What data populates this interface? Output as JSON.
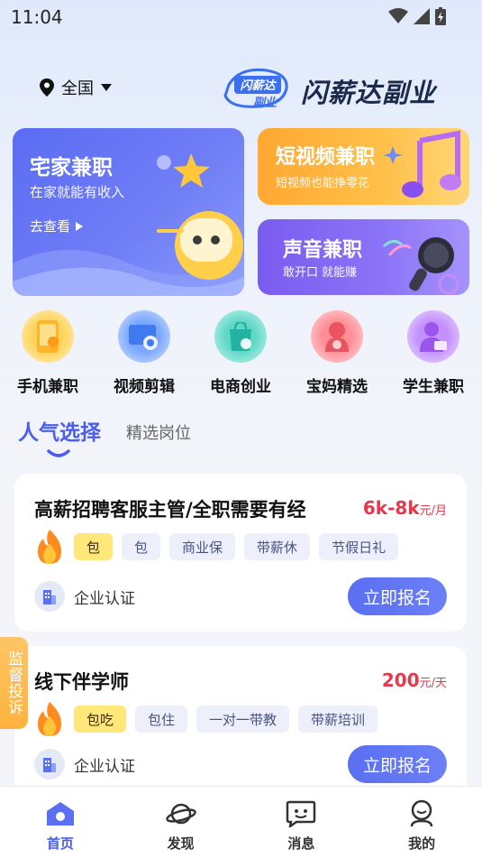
{
  "status_bar": {
    "time": "11:04"
  },
  "header": {
    "location": "全国",
    "brand_name": "闪薪达副业",
    "logo_mark_text": "闪薪达副业"
  },
  "banners": {
    "home": {
      "title": "宅家兼职",
      "subtitle": "在家就能有收入",
      "link": "去查看"
    },
    "video": {
      "title": "短视频兼职",
      "subtitle": "短视频也能挣零花"
    },
    "voice": {
      "title": "声音兼职",
      "subtitle": "敢开口 就能赚"
    }
  },
  "categories": [
    {
      "label": "手机兼职",
      "icon": "phone-icon",
      "color": "#ffc94a"
    },
    {
      "label": "视频剪辑",
      "icon": "video-edit-icon",
      "color": "#5b8ff5"
    },
    {
      "label": "电商创业",
      "icon": "shopping-bag-icon",
      "color": "#3ec6b8"
    },
    {
      "label": "宝妈精选",
      "icon": "mom-icon",
      "color": "#f0707a"
    },
    {
      "label": "学生兼职",
      "icon": "student-icon",
      "color": "#a86ef0"
    }
  ],
  "tabs": {
    "active": "人气选择",
    "other": "精选岗位"
  },
  "jobs": [
    {
      "title": "高薪招聘客服主管/全职需要有经",
      "salary": "6k-8k",
      "unit": "元/月",
      "tags": [
        "包",
        "包",
        "商业保",
        "带薪休",
        "节假日礼"
      ],
      "verify": "企业认证",
      "apply": "立即报名"
    },
    {
      "title": "线下伴学师",
      "salary": "200",
      "unit": "元/天",
      "tags": [
        "包吃",
        "包住",
        "一对一带教",
        "带薪培训"
      ],
      "verify": "企业认证",
      "apply": "立即报名"
    }
  ],
  "side_tab": "监督投诉",
  "nav": [
    {
      "label": "首页",
      "icon": "home-icon",
      "active": true
    },
    {
      "label": "发现",
      "icon": "planet-icon",
      "active": false
    },
    {
      "label": "消息",
      "icon": "message-icon",
      "active": false
    },
    {
      "label": "我的",
      "icon": "profile-icon",
      "active": false
    }
  ],
  "colors": {
    "accent": "#4a5df0",
    "salary": "#e8374b",
    "hot_tag": "#ffe879"
  }
}
